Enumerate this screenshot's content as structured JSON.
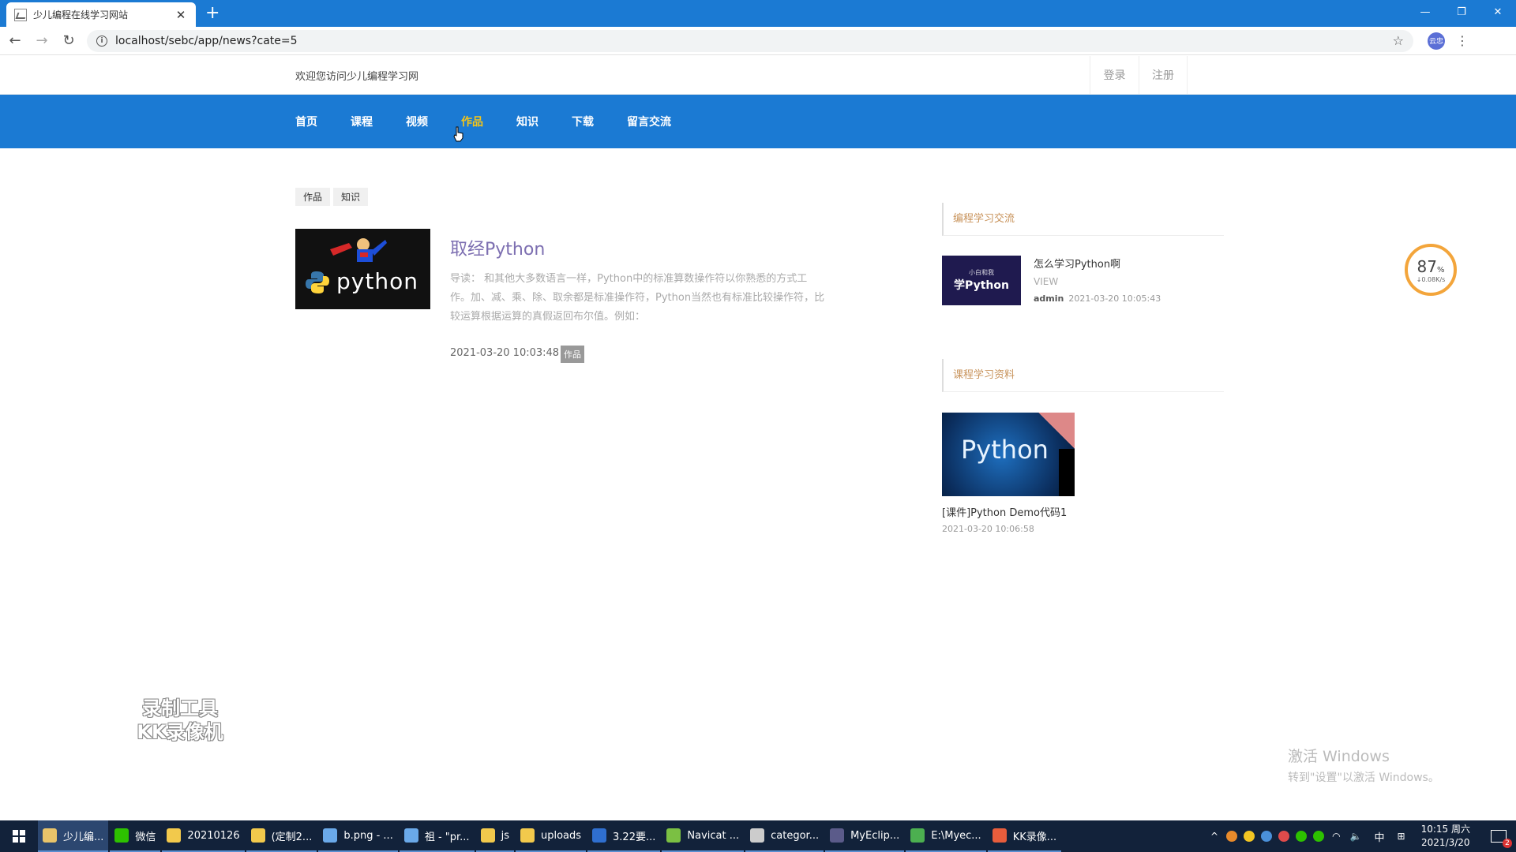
{
  "browser": {
    "tab_title": "少儿编程在线学习网站",
    "new_tab": "+",
    "url": "localhost/sebc/app/news?cate=5",
    "profile": "云忠"
  },
  "site": {
    "welcome": "欢迎您访问少儿编程学习网",
    "auth": {
      "login": "登录",
      "register": "注册"
    },
    "nav": [
      "首页",
      "课程",
      "视频",
      "作品",
      "知识",
      "下载",
      "留言交流"
    ],
    "active_nav": "作品"
  },
  "filters": [
    "作品",
    "知识"
  ],
  "article": {
    "thumb_text": "python",
    "title": "取经Python",
    "summary": "导读： 和其他大多数语言一样，Python中的标准算数操作符以你熟悉的方式工作。加、减、乘、除、取余都是标准操作符，Python当然也有标准比较操作符，比较运算根据运算的真假返回布尔值。例如：",
    "date": "2021-03-20 10:03:48",
    "tag": "作品"
  },
  "sidebar": {
    "section1_title": "编程学习交流",
    "post": {
      "thumb_small": "小白和我",
      "thumb_big": "学Python",
      "title": "怎么学习Python啊",
      "view": "VIEW",
      "author": "admin",
      "date": "2021-03-20 10:05:43"
    },
    "section2_title": "课程学习资料",
    "course": {
      "thumb_text": "Python",
      "title": "[课件]Python Demo代码1",
      "date": "2021-03-20 10:06:58"
    }
  },
  "speed_widget": {
    "percent": "87",
    "unit": "%",
    "rate": "↓0.08K/s"
  },
  "watermark": {
    "line1": "录制工具",
    "line2": "KK录像机"
  },
  "activation": {
    "line1": "激活 Windows",
    "line2": "转到\"设置\"以激活 Windows。"
  },
  "taskbar": {
    "items": [
      {
        "label": "少儿编...",
        "color": "#e9c46a"
      },
      {
        "label": "微信",
        "color": "#2dc100"
      },
      {
        "label": "20210126",
        "color": "#f2c94c"
      },
      {
        "label": "(定制2...",
        "color": "#f2c94c"
      },
      {
        "label": "b.png - ...",
        "color": "#6aa9e9"
      },
      {
        "label": "祖 - \"pr...",
        "color": "#6aa9e9"
      },
      {
        "label": "js",
        "color": "#f2c94c"
      },
      {
        "label": "uploads",
        "color": "#f2c94c"
      },
      {
        "label": "3.22要...",
        "color": "#2f6fd0"
      },
      {
        "label": "Navicat ...",
        "color": "#7bc043"
      },
      {
        "label": "categor...",
        "color": "#cccccc"
      },
      {
        "label": "MyEclip...",
        "color": "#5b5b8a"
      },
      {
        "label": "E:\\Myec...",
        "color": "#4caf50"
      },
      {
        "label": "KK录像...",
        "color": "#e85d3c"
      }
    ],
    "ime": "中",
    "time": "10:15 周六",
    "date": "2021/3/20"
  }
}
